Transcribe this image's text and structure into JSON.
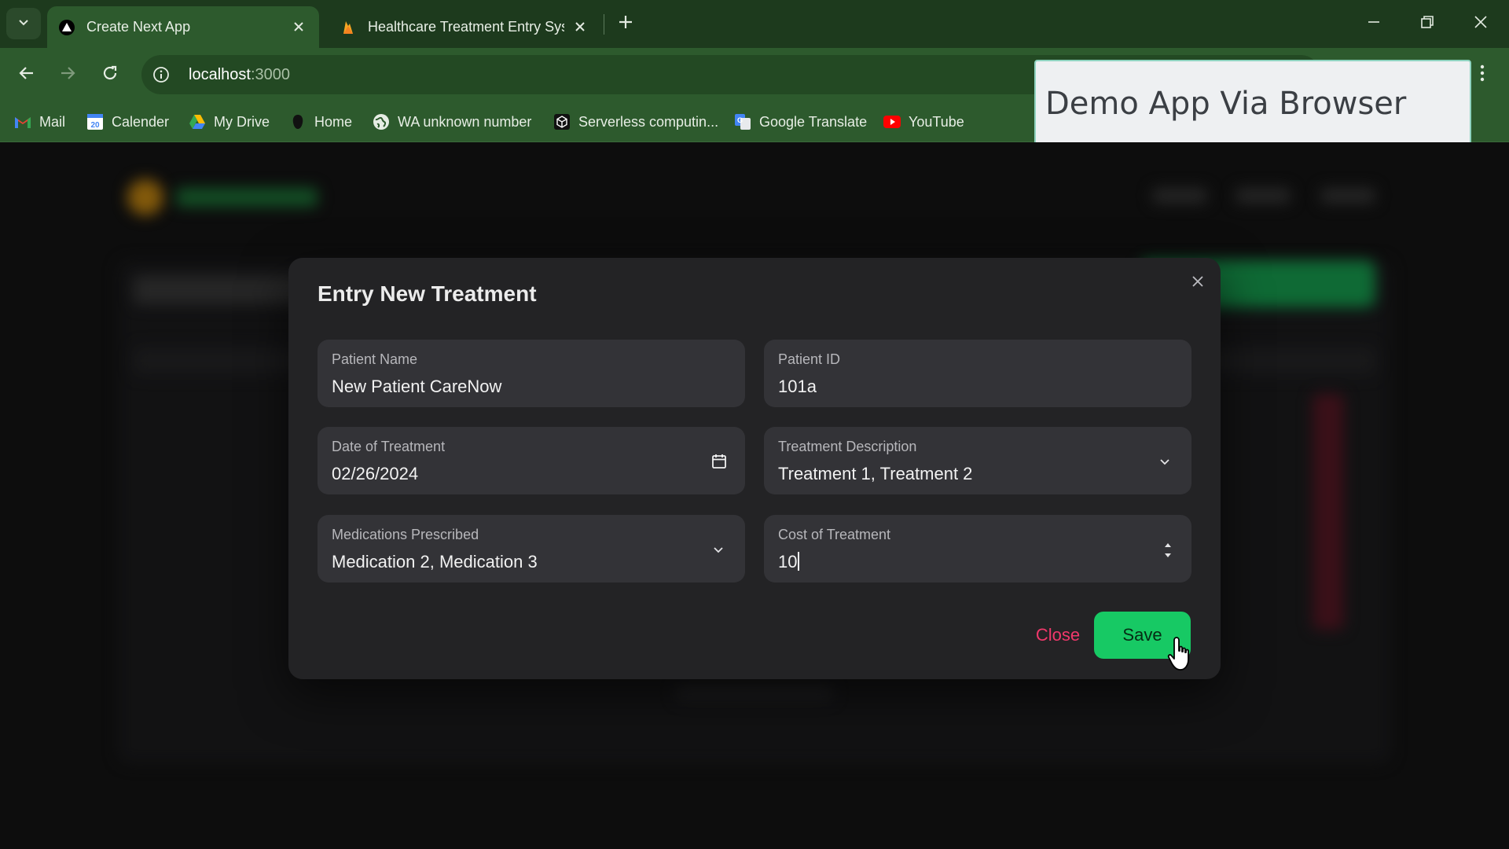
{
  "browser": {
    "tabs": [
      {
        "title": "Create Next App",
        "active": true
      },
      {
        "title": "Healthcare Treatment Entry Sys",
        "active": false
      }
    ],
    "url": {
      "host": "localhost",
      "port": ":3000"
    },
    "bookmarks": [
      {
        "label": "Mail",
        "icon": "gmail-icon"
      },
      {
        "label": "Calender",
        "icon": "calendar-icon"
      },
      {
        "label": "My Drive",
        "icon": "drive-icon"
      },
      {
        "label": "Home",
        "icon": "home-favicon-icon"
      },
      {
        "label": "WA unknown number",
        "icon": "globe-icon"
      },
      {
        "label": "Serverless computin...",
        "icon": "cube-icon"
      },
      {
        "label": "Google Translate",
        "icon": "translate-icon"
      },
      {
        "label": "YouTube",
        "icon": "youtube-icon"
      }
    ]
  },
  "overlay": {
    "text": "Demo App Via Browser"
  },
  "modal": {
    "title": "Entry New Treatment",
    "fields": {
      "patient_name": {
        "label": "Patient Name",
        "value": "New Patient CareNow"
      },
      "patient_id": {
        "label": "Patient ID",
        "value": "101a"
      },
      "date": {
        "label": "Date of Treatment",
        "value": "02/26/2024"
      },
      "treatment_description": {
        "label": "Treatment Description",
        "value": "Treatment 1, Treatment 2"
      },
      "medications": {
        "label": "Medications Prescribed",
        "value": "Medication 2, Medication 3"
      },
      "cost": {
        "label": "Cost of Treatment",
        "value": "10"
      }
    },
    "buttons": {
      "close": "Close",
      "save": "Save"
    }
  },
  "colors": {
    "tab_bar": "#1d3a1d",
    "toolbar": "#2d5a2d",
    "modal_bg": "#232325",
    "field_bg": "#333337",
    "save_green": "#17c964",
    "close_red": "#f0386b"
  }
}
